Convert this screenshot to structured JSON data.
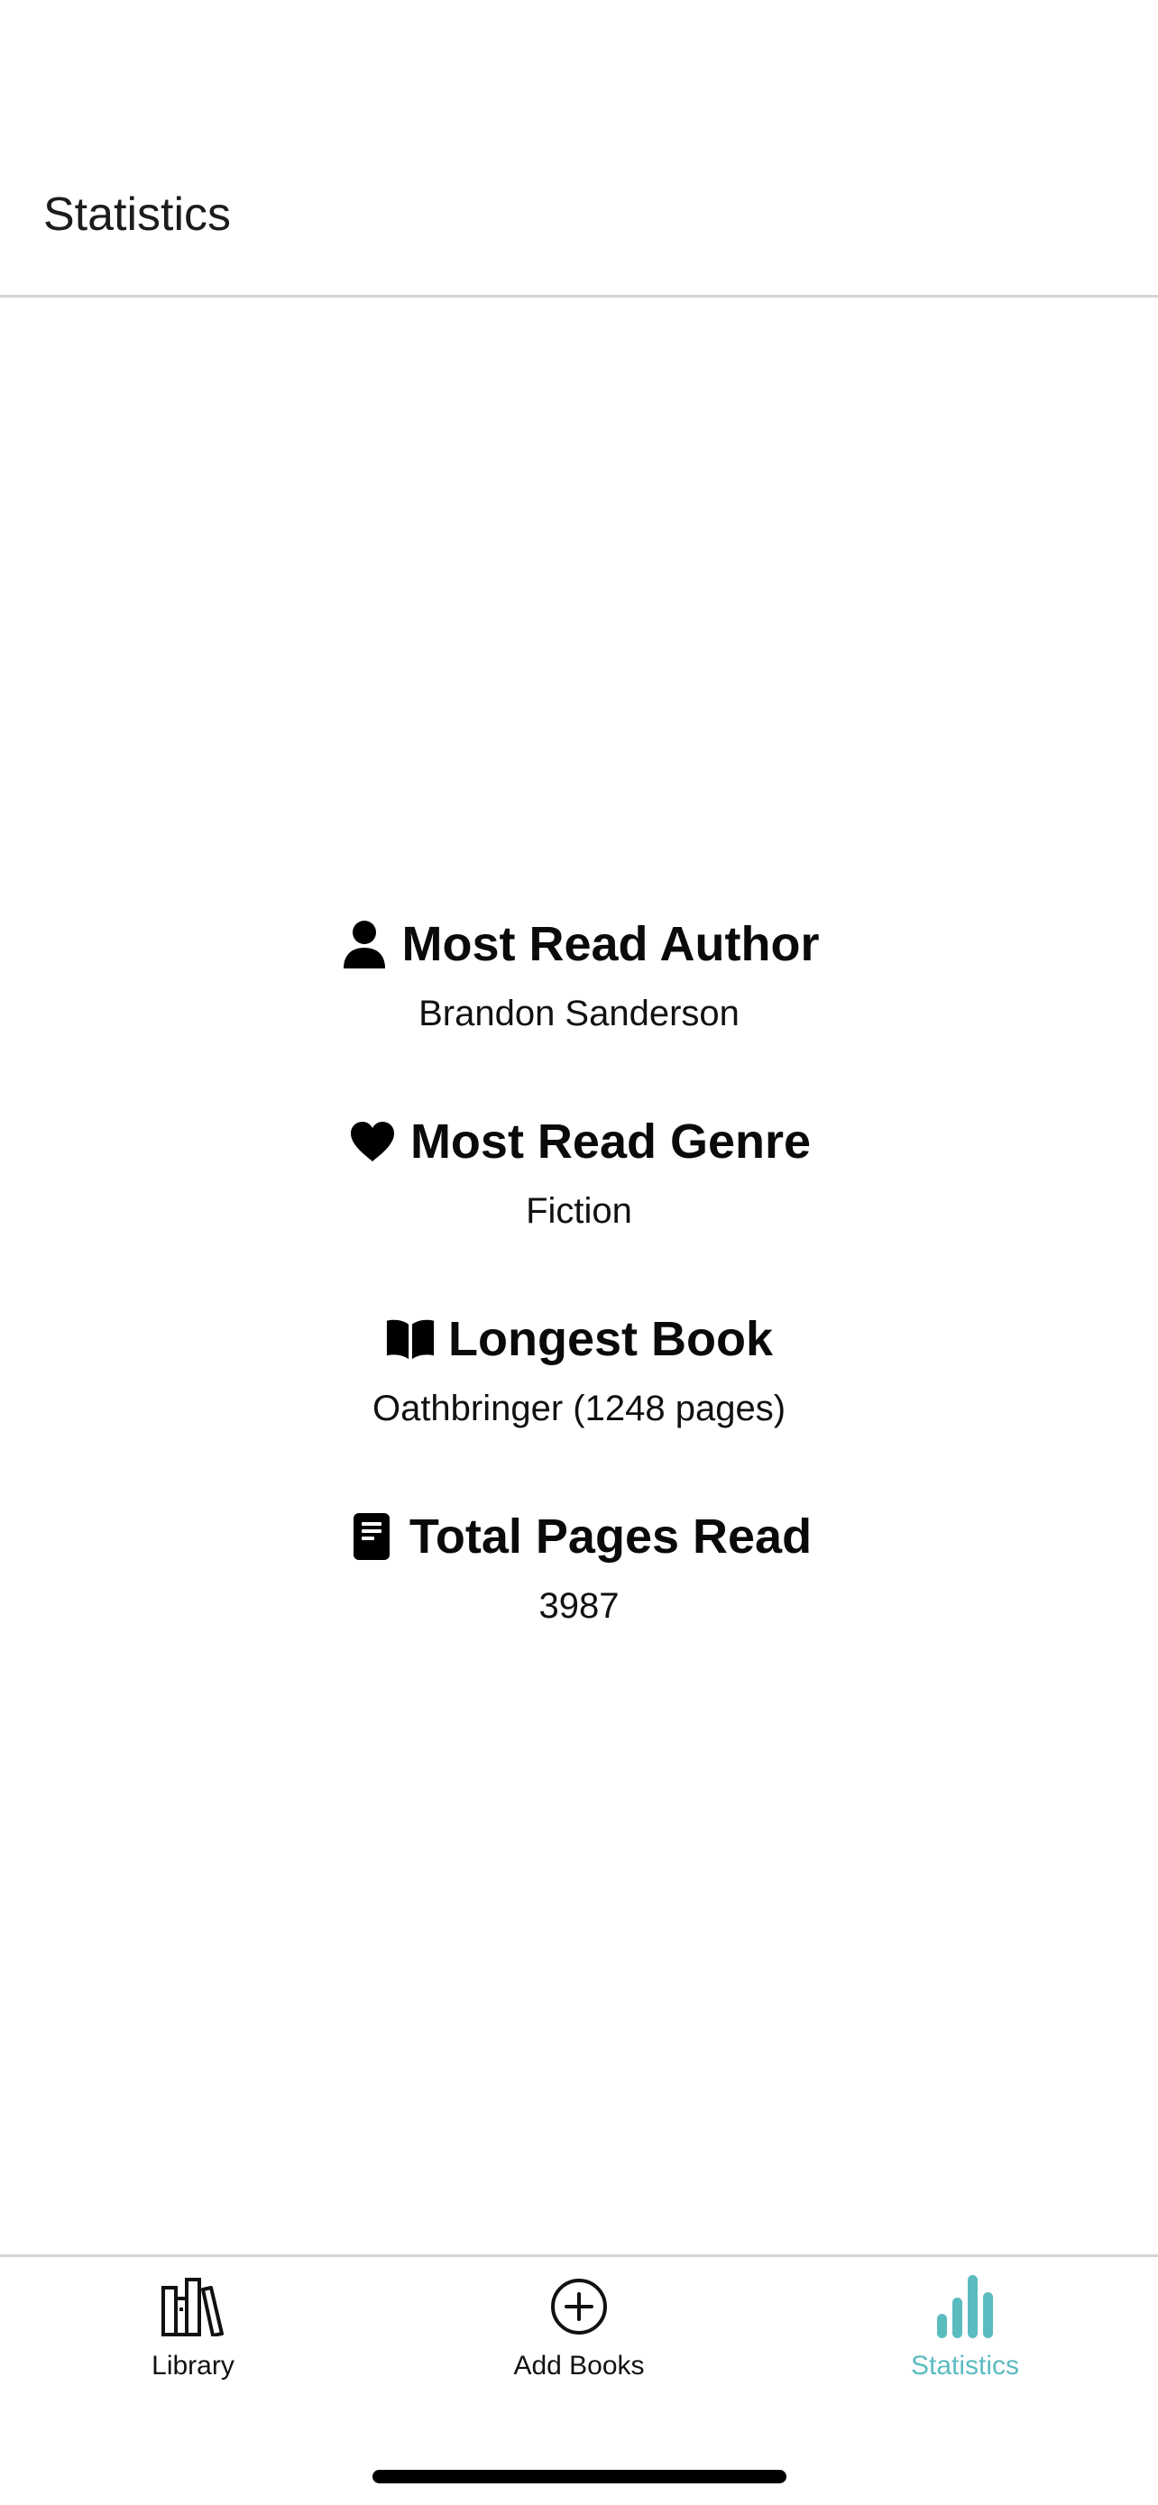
{
  "header": {
    "title": "Statistics"
  },
  "stats": [
    {
      "icon": "person-icon",
      "label": "Most Read Author",
      "value": "Brandon Sanderson"
    },
    {
      "icon": "heart-icon",
      "label": "Most Read Genre",
      "value": "Fiction"
    },
    {
      "icon": "open-book-icon",
      "label": "Longest Book",
      "value": "Oathbringer (1248 pages)"
    },
    {
      "icon": "book-icon",
      "label": "Total Pages Read",
      "value": "3987"
    }
  ],
  "tabbar": {
    "tabs": [
      {
        "icon": "library-icon",
        "label": "Library",
        "active": false
      },
      {
        "icon": "add-circle-icon",
        "label": "Add Books",
        "active": false
      },
      {
        "icon": "bar-chart-icon",
        "label": "Statistics",
        "active": true
      }
    ]
  },
  "colors": {
    "accent": "#5bbcc0",
    "text": "#111111",
    "divider": "#d4d4d4",
    "background": "#ffffff"
  }
}
